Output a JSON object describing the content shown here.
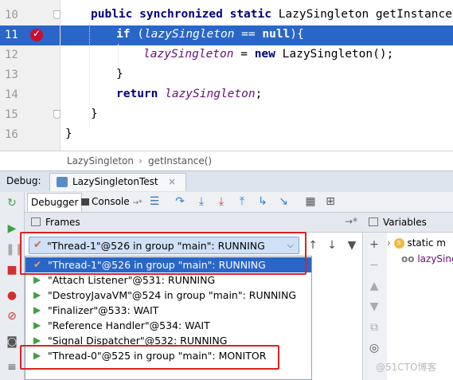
{
  "editor": {
    "lines": [
      {
        "num": "10",
        "tokens": [
          {
            "t": "kw",
            "v": "public synchronized static "
          },
          {
            "t": "n",
            "v": "LazySingleton getInstance(){"
          }
        ]
      },
      {
        "num": "11",
        "tokens": [
          {
            "t": "kw",
            "v": "if "
          },
          {
            "t": "n",
            "v": "("
          },
          {
            "t": "fld",
            "v": "lazySingleton"
          },
          {
            "t": "n",
            "v": " == "
          },
          {
            "t": "kw",
            "v": "null"
          },
          {
            "t": "n",
            "v": "){"
          }
        ]
      },
      {
        "num": "12",
        "tokens": [
          {
            "t": "fld",
            "v": "lazySingleton"
          },
          {
            "t": "n",
            "v": " = "
          },
          {
            "t": "kw",
            "v": "new "
          },
          {
            "t": "n",
            "v": "LazySingleton();"
          }
        ]
      },
      {
        "num": "13",
        "tokens": [
          {
            "t": "n",
            "v": "}"
          }
        ]
      },
      {
        "num": "14",
        "tokens": [
          {
            "t": "kw",
            "v": "return "
          },
          {
            "t": "fld",
            "v": "lazySingleton"
          },
          {
            "t": "n",
            "v": ";"
          }
        ]
      },
      {
        "num": "15",
        "tokens": [
          {
            "t": "n",
            "v": "}"
          }
        ]
      },
      {
        "num": "16",
        "tokens": [
          {
            "t": "n",
            "v": "}"
          }
        ]
      }
    ],
    "current_line": "11",
    "breakpoint_line": "11"
  },
  "breadcrumb": {
    "class_name": "LazySingleton",
    "separator": "›",
    "method": "getInstance()"
  },
  "debug": {
    "label": "Debug:",
    "run_tab": "LazySingletonTest",
    "tabs": {
      "debugger": "Debugger",
      "console": "Console",
      "console_suffix": "→*"
    }
  },
  "frames": {
    "title": "Frames",
    "pin": "→*",
    "selected_thread": "\"Thread-1\"@526 in group \"main\": RUNNING",
    "threads": [
      {
        "label": "\"Thread-1\"@526 in group \"main\": RUNNING",
        "state_icon": "check-icon",
        "selected": true
      },
      {
        "label": "\"Attach Listener\"@531: RUNNING",
        "state_icon": "play-icon"
      },
      {
        "label": "\"DestroyJavaVM\"@524 in group \"main\": RUNNING",
        "state_icon": "play-icon"
      },
      {
        "label": "\"Finalizer\"@533: WAIT",
        "state_icon": "play-icon"
      },
      {
        "label": "\"Reference Handler\"@534: WAIT",
        "state_icon": "play-icon"
      },
      {
        "label": "\"Signal Dispatcher\"@532: RUNNING",
        "state_icon": "play-icon"
      },
      {
        "label": "\"Thread-0\"@525 in group \"main\": MONITOR",
        "state_icon": "play-icon"
      }
    ]
  },
  "variables": {
    "title": "Variables",
    "items": [
      {
        "badge": "s",
        "label": "static m"
      },
      {
        "badge": "oo",
        "label": "lazySing"
      }
    ]
  },
  "watermark": "@51CTO博客",
  "colors": {
    "accent": "#2a66c8",
    "annotation": "#e02020",
    "breakpoint": "#c8102e"
  }
}
